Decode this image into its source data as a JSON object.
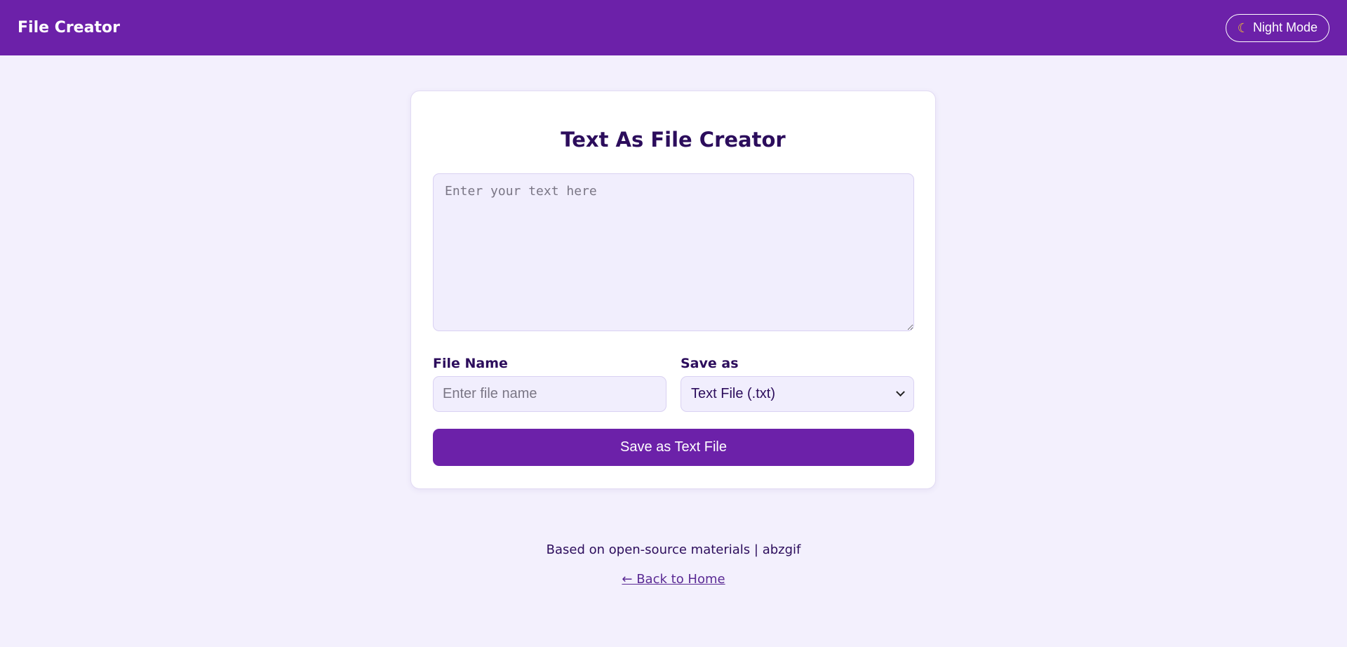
{
  "header": {
    "brand": "File Creator",
    "night_mode_label": "Night Mode",
    "night_mode_icon": "moon-icon"
  },
  "card": {
    "title": "Text As File Creator",
    "textarea_placeholder": "Enter your text here",
    "textarea_value": "",
    "file_name_label": "File Name",
    "file_name_placeholder": "Enter file name",
    "file_name_value": "",
    "save_as_label": "Save as",
    "save_as_selected": "Text File (.txt)",
    "save_button_label": "Save as Text File"
  },
  "footer": {
    "credit": "Based on open-source materials | abzgif",
    "back_link": "← Back to Home"
  },
  "colors": {
    "brand": "#6c21a9",
    "background": "#f3f0fd",
    "text": "#2c0d5c"
  }
}
